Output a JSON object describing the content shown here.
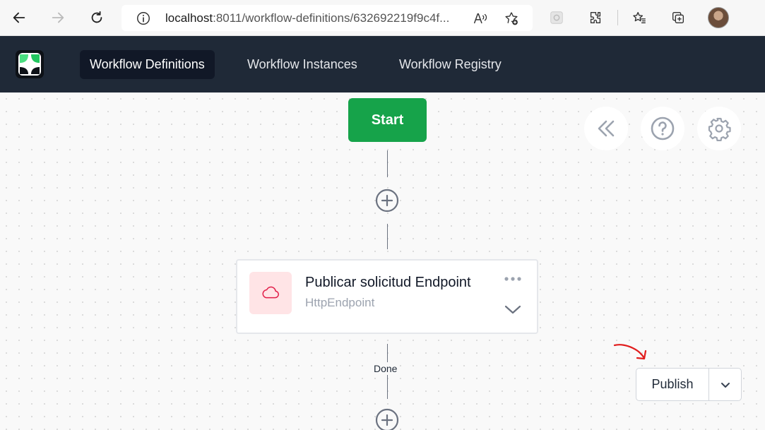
{
  "browser": {
    "url_host": "localhost",
    "url_rest": ":8011/workflow-definitions/632692219f9c4f..."
  },
  "icons": {
    "back": "arrow-left-icon",
    "forward": "arrow-right-icon",
    "reload": "reload-icon",
    "info": "info-icon",
    "read_aloud": "read-aloud-icon",
    "favorite_add": "star-add-icon",
    "extensions": "puzzle-icon",
    "favorites": "favorites-icon",
    "collections": "collections-icon",
    "profile": "avatar",
    "activity": "cloud-icon",
    "more": "more-dots-icon",
    "expand": "chevron-down-icon",
    "collapse_panel": "double-chevron-left-icon",
    "help": "question-circle-icon",
    "settings": "gear-icon",
    "add": "plus-circle-icon"
  },
  "app": {
    "nav": [
      {
        "label": "Workflow Definitions"
      },
      {
        "label": "Workflow Instances"
      },
      {
        "label": "Workflow Registry"
      }
    ]
  },
  "designer": {
    "start_label": "Start",
    "activity": {
      "title": "Publicar solicitud Endpoint",
      "type": "HttpEndpoint"
    },
    "outcome_label": "Done",
    "publish_label": "Publish"
  },
  "colors": {
    "header_bg": "#1f2937",
    "start_green": "#16a34a",
    "activity_icon_bg": "#ffe4e6",
    "activity_icon_stroke": "#e11d48",
    "annotation_red": "#e11d1d"
  }
}
